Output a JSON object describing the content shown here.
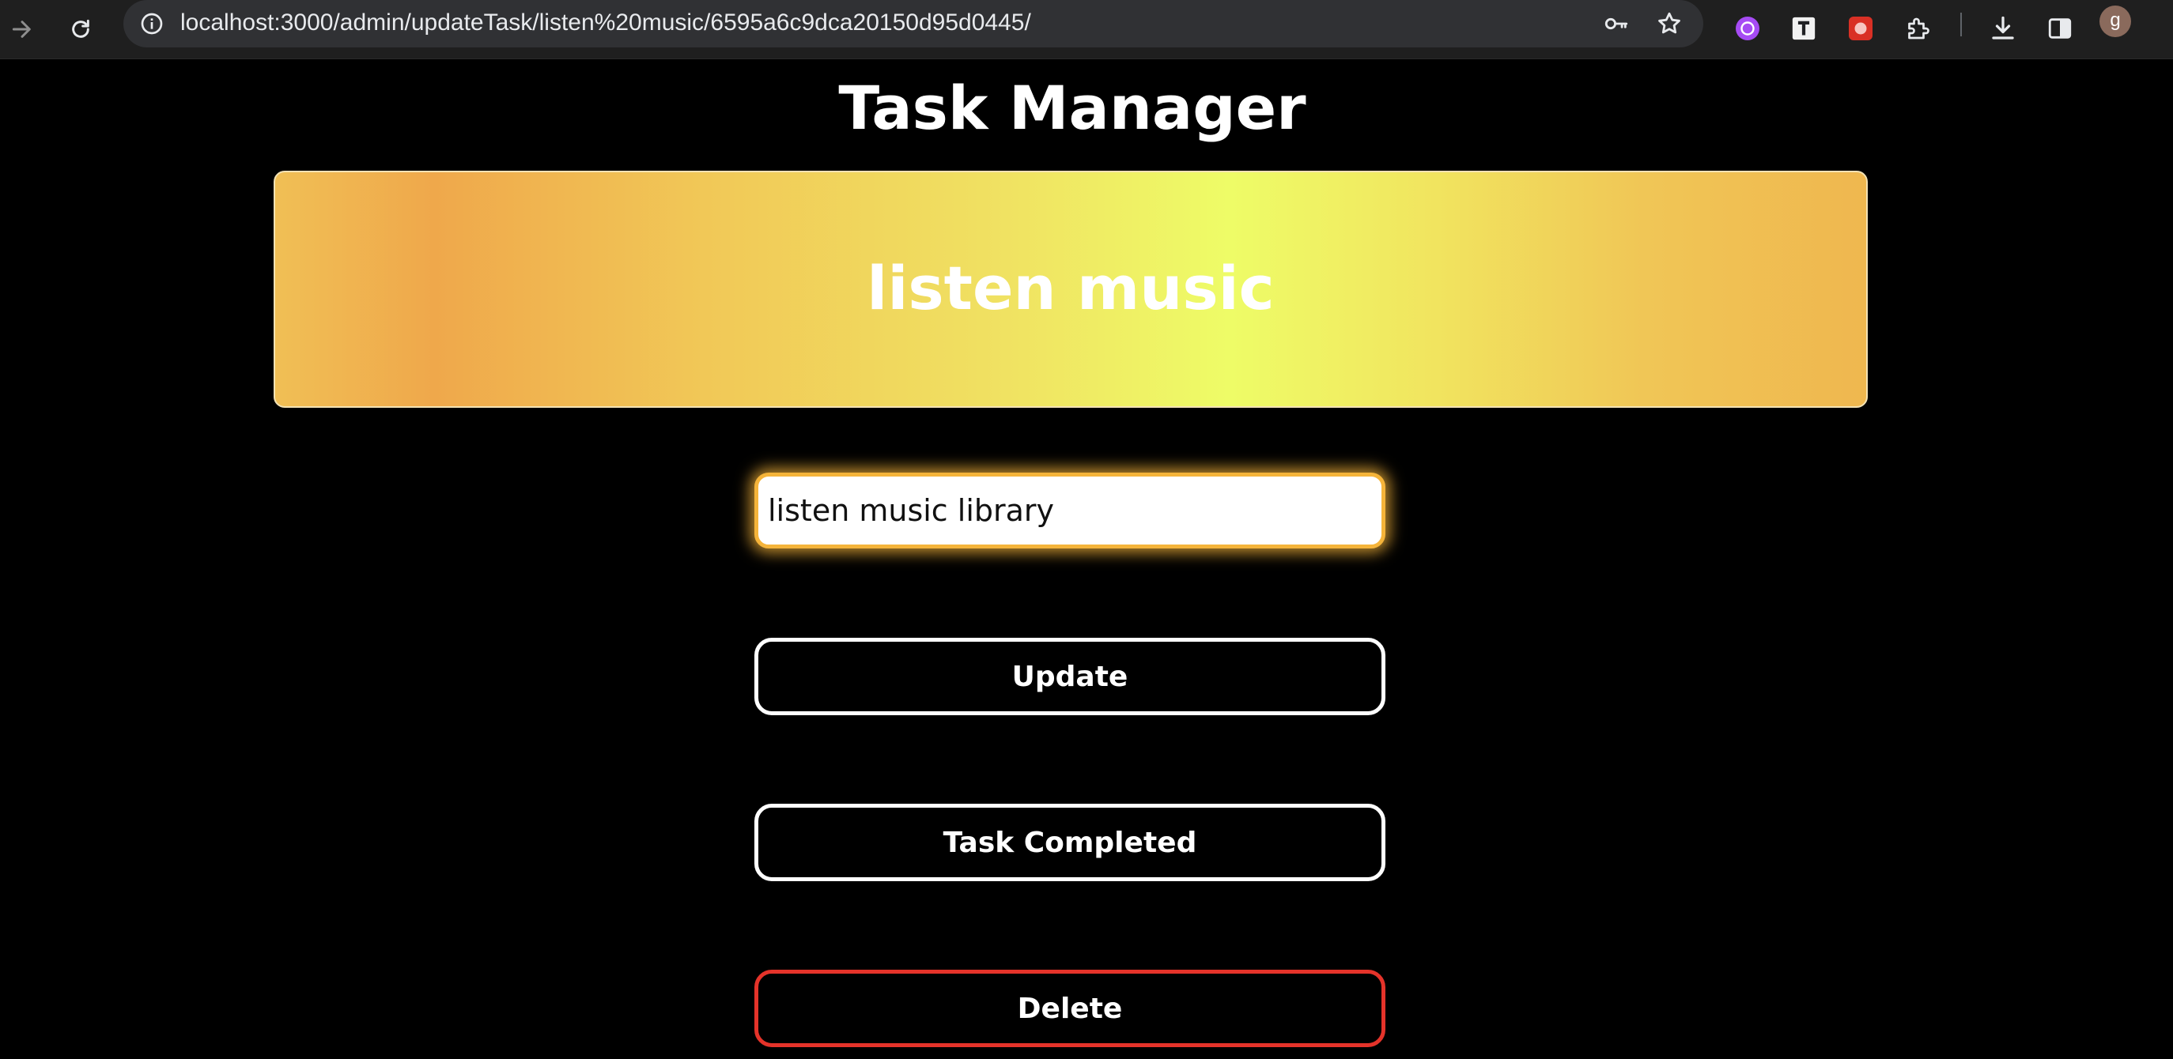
{
  "browser": {
    "url": "localhost:3000/admin/updateTask/listen%20music/6595a6c9dca20150d95d0445/",
    "icons": {
      "back": "arrow-right-icon",
      "reload": "reload-icon",
      "site_info": "info-icon",
      "password": "key-icon",
      "bookmark": "star-icon",
      "extensions": [
        "purple-extension-icon",
        "t-extension-icon",
        "red-extension-icon",
        "puzzle-extension-icon"
      ],
      "download": "download-icon",
      "side_panel": "side-panel-icon"
    },
    "profile_initial": "g"
  },
  "page": {
    "title": "Task Manager",
    "task_name": "listen music",
    "input_value": "listen music library",
    "buttons": {
      "update": "Update",
      "completed": "Task Completed",
      "delete": "Delete"
    }
  },
  "colors": {
    "background": "#000000",
    "card_gradient": [
      "#efa84b",
      "#eefc67"
    ],
    "input_glow": "#f5b43a",
    "delete_border": "#e5332a",
    "button_border": "#ffffff"
  }
}
